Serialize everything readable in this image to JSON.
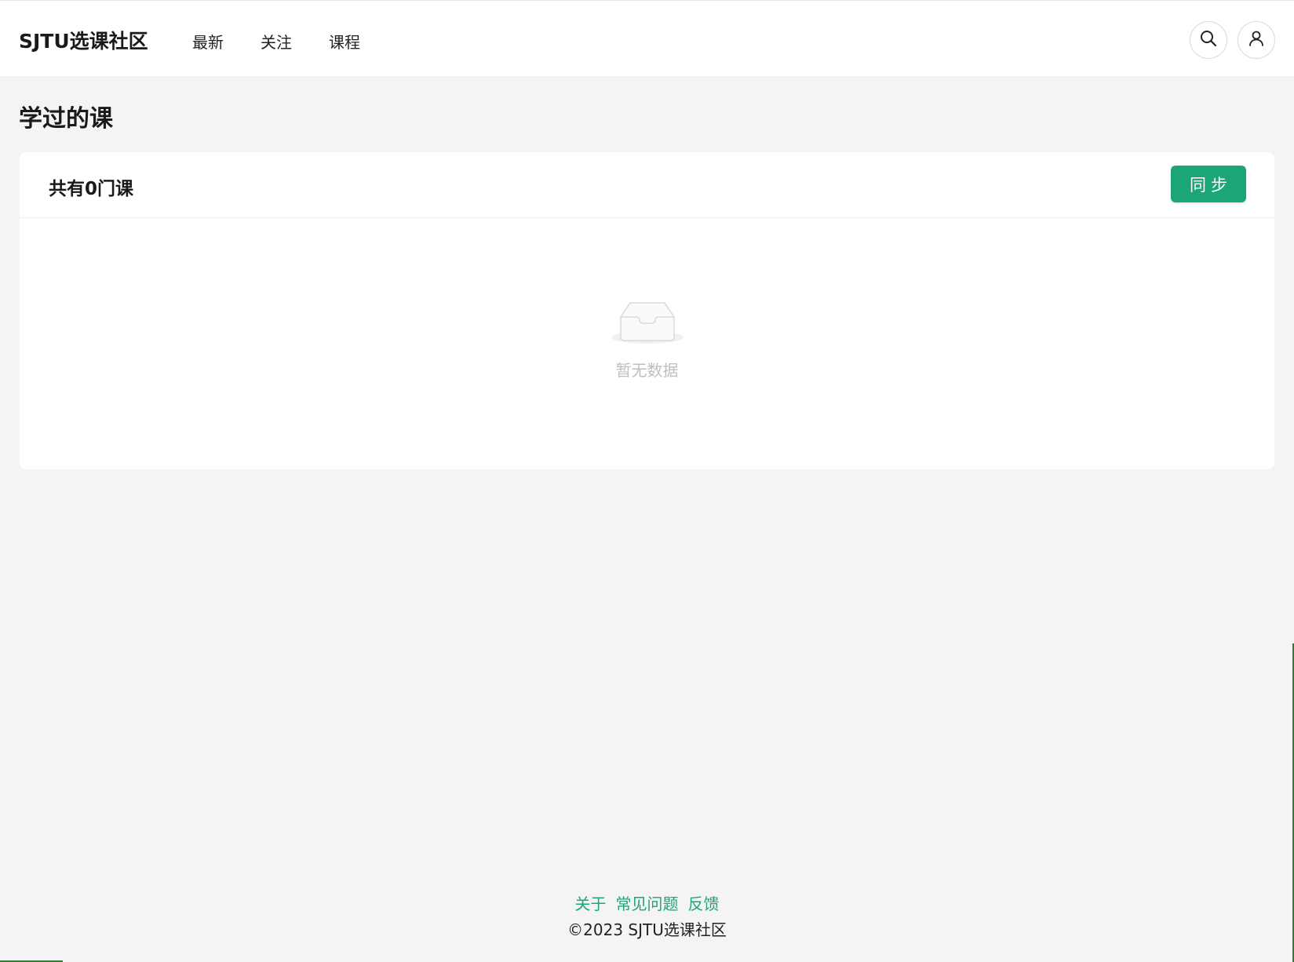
{
  "header": {
    "brand": "SJTU选课社区",
    "nav": [
      {
        "label": "最新"
      },
      {
        "label": "关注"
      },
      {
        "label": "课程"
      }
    ],
    "search_icon": "search-icon",
    "user_icon": "user-icon"
  },
  "main": {
    "title": "学过的课",
    "card": {
      "summary": "共有0门课",
      "sync_label": "同步",
      "empty_icon": "inbox-icon",
      "empty_text": "暂无数据"
    }
  },
  "footer": {
    "links": [
      {
        "label": "关于"
      },
      {
        "label": "常见问题"
      },
      {
        "label": "反馈"
      }
    ],
    "copyright": "©2023 SJTU选课社区"
  },
  "colors": {
    "accent": "#1da57a",
    "background": "#f4f4f4",
    "surface": "#ffffff",
    "muted_text": "#bfbfbf"
  }
}
